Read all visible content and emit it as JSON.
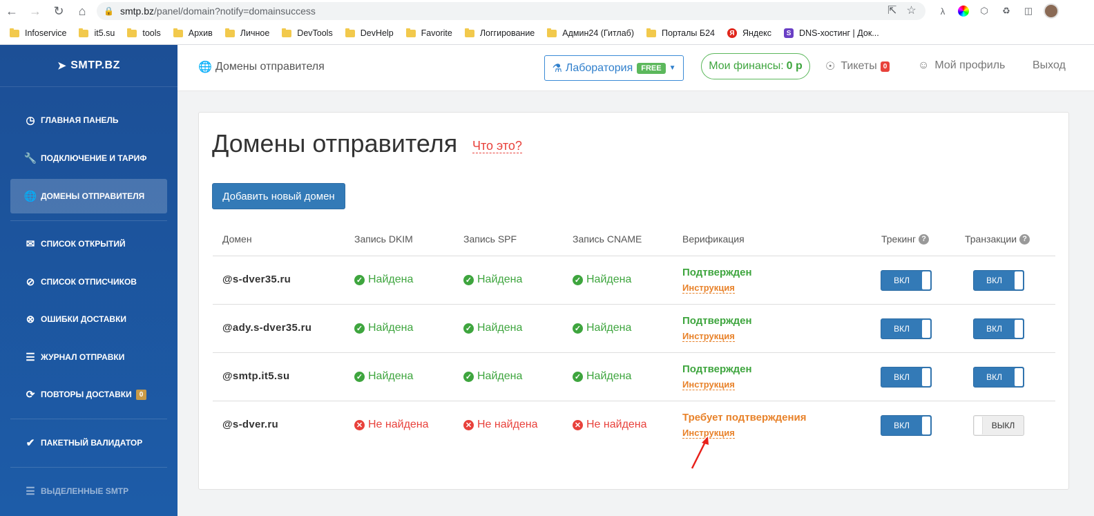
{
  "browser": {
    "url_host": "smtp.bz",
    "url_path": "/panel/domain?notify=domainsuccess",
    "bookmarks": [
      {
        "label": "Infoservice",
        "icon": "folder"
      },
      {
        "label": "it5.su",
        "icon": "folder"
      },
      {
        "label": "tools",
        "icon": "folder"
      },
      {
        "label": "Архив",
        "icon": "folder"
      },
      {
        "label": "Личное",
        "icon": "folder"
      },
      {
        "label": "DevTools",
        "icon": "folder"
      },
      {
        "label": "DevHelp",
        "icon": "folder"
      },
      {
        "label": "Favorite",
        "icon": "folder"
      },
      {
        "label": "Логгирование",
        "icon": "folder"
      },
      {
        "label": "Админ24 (Гитлаб)",
        "icon": "folder"
      },
      {
        "label": "Порталы Б24",
        "icon": "folder"
      },
      {
        "label": "Яндекс",
        "icon": "yandex"
      },
      {
        "label": "DNS-хостинг | Док...",
        "icon": "s-logo"
      }
    ]
  },
  "sidebar": {
    "logo": "SMTP.BZ",
    "items": [
      {
        "label": "Главная панель",
        "icon": "gauge-icon"
      },
      {
        "label": "Подключение и тариф",
        "icon": "wrench-icon"
      },
      {
        "label": "Домены отправителя",
        "icon": "globe-icon",
        "active": true
      },
      {
        "label": "Список открытий",
        "icon": "envelope-open-icon"
      },
      {
        "label": "Список отписчиков",
        "icon": "ban-icon"
      },
      {
        "label": "Ошибки доставки",
        "icon": "x-circle-icon"
      },
      {
        "label": "Журнал отправки",
        "icon": "list-icon"
      },
      {
        "label": "Повторы доставки",
        "icon": "repeat-icon",
        "badge": "0"
      },
      {
        "label": "Пакетный валидатор",
        "icon": "check-circle-icon"
      },
      {
        "label": "Выделенные SMTP",
        "icon": "layers-icon",
        "disabled": true
      }
    ]
  },
  "header": {
    "breadcrumb": "Домены отправителя",
    "lab_label": "Лаборатория",
    "lab_badge": "FREE",
    "finance_label": "Мои финансы:",
    "finance_value": "0 р",
    "tickets_label": "Тикеты",
    "tickets_count": "0",
    "profile_label": "Мой профиль",
    "logout_label": "Выход"
  },
  "main": {
    "title": "Домены отправителя",
    "help_link": "Что это?",
    "add_button": "Добавить новый домен",
    "columns": {
      "domain": "Домен",
      "dkim": "Запись DKIM",
      "spf": "Запись SPF",
      "cname": "Запись CNAME",
      "verification": "Верификация",
      "tracking": "Трекинг",
      "transactions": "Транзакции"
    },
    "rows": [
      {
        "domain": "@s-dver35.ru",
        "dkim": "Найдена",
        "spf": "Найдена",
        "cname": "Найдена",
        "verification": "Подтвержден",
        "instruction": "Инструкция",
        "tracking": "ВКЛ",
        "transactions": "ВКЛ"
      },
      {
        "domain": "@ady.s-dver35.ru",
        "dkim": "Найдена",
        "spf": "Найдена",
        "cname": "Найдена",
        "verification": "Подтвержден",
        "instruction": "Инструкция",
        "tracking": "ВКЛ",
        "transactions": "ВКЛ"
      },
      {
        "domain": "@smtp.it5.su",
        "dkim": "Найдена",
        "spf": "Найдена",
        "cname": "Найдена",
        "verification": "Подтвержден",
        "instruction": "Инструкция",
        "tracking": "ВКЛ",
        "transactions": "ВКЛ"
      },
      {
        "domain": "@s-dver.ru",
        "dkim": "Не найдена",
        "spf": "Не найдена",
        "cname": "Не найдена",
        "verification": "Требует подтверждения",
        "instruction": "Инструкция",
        "tracking": "ВКЛ",
        "transactions": "ВЫКЛ"
      }
    ]
  },
  "colors": {
    "sidebar": "#1c4f96",
    "primary": "#337ab7",
    "success": "#3ea53e",
    "danger": "#e8413b",
    "warning": "#e8822a"
  }
}
